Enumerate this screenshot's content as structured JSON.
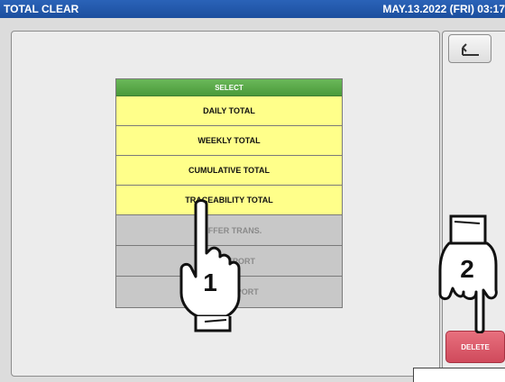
{
  "titlebar": {
    "title": "TOTAL CLEAR",
    "datetime": "MAY.13.2022 (FRI)  03:17"
  },
  "select_menu": {
    "header": "SELECT",
    "items": [
      {
        "label": "DAILY TOTAL",
        "enabled": true
      },
      {
        "label": "WEEKLY TOTAL",
        "enabled": true
      },
      {
        "label": "CUMULATIVE TOTAL",
        "enabled": true
      },
      {
        "label": "TRACEABILITY TOTAL",
        "enabled": true
      },
      {
        "label": "BUFFER TRANS.",
        "enabled": false
      },
      {
        "label": "PLU REPORT",
        "enabled": false
      },
      {
        "label": "DEPT. REPORT",
        "enabled": false
      }
    ]
  },
  "side": {
    "back_icon": "return-arrow-icon",
    "delete_label": "DELETE"
  },
  "callouts": {
    "step1": "1",
    "step2": "2"
  },
  "colors": {
    "titlebar": "#1f55a6",
    "header_green": "#5aa84a",
    "item_yellow": "#ffff8a",
    "delete_red": "#d95566"
  }
}
